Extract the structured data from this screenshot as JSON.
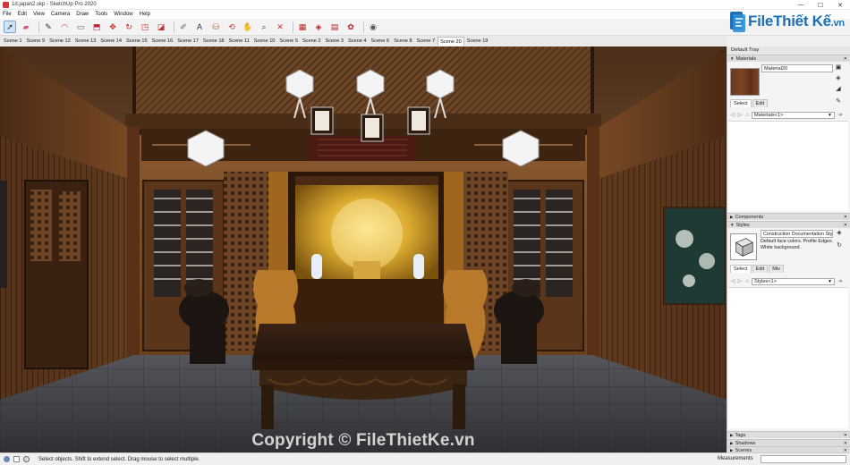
{
  "window": {
    "title": "1d.japan2.skp - SketchUp Pro 2020",
    "controls": [
      "—",
      "☐",
      "✕"
    ]
  },
  "menu": [
    "File",
    "Edit",
    "View",
    "Camera",
    "Draw",
    "Tools",
    "Window",
    "Help"
  ],
  "toolbar": {
    "tools": [
      {
        "icon": "select-arrow-icon",
        "glyph": "➚",
        "active": true
      },
      {
        "icon": "eraser-icon",
        "glyph": "▰",
        "color": "#d55a7a"
      },
      {
        "icon": "pencil-line-icon",
        "glyph": "✎",
        "color": "#333"
      },
      {
        "icon": "arc-icon",
        "glyph": "◠",
        "color": "#c33"
      },
      {
        "icon": "rectangle-icon",
        "glyph": "▭",
        "color": "#7a5a3a"
      },
      {
        "icon": "push-pull-icon",
        "glyph": "⬒",
        "color": "#b23"
      },
      {
        "icon": "move-icon",
        "glyph": "✥",
        "color": "#c22"
      },
      {
        "icon": "rotate-icon",
        "glyph": "↻",
        "color": "#c22"
      },
      {
        "icon": "scale-icon",
        "glyph": "◳",
        "color": "#c22"
      },
      {
        "icon": "offset-icon",
        "glyph": "◪",
        "color": "#b33"
      },
      {
        "icon": "tape-measure-icon",
        "glyph": "✐",
        "color": "#666"
      },
      {
        "icon": "text-icon",
        "glyph": "A",
        "color": "#333"
      },
      {
        "icon": "paint-bucket-icon",
        "glyph": "⛁",
        "color": "#a63"
      },
      {
        "icon": "orbit-icon",
        "glyph": "⟲",
        "color": "#b33"
      },
      {
        "icon": "pan-icon",
        "glyph": "✋",
        "color": "#a52"
      },
      {
        "icon": "zoom-icon",
        "glyph": "⌕",
        "color": "#333"
      },
      {
        "icon": "zoom-extents-icon",
        "glyph": "✕",
        "color": "#c33"
      },
      {
        "icon": "warehouse-icon",
        "glyph": "▦",
        "color": "#b22"
      },
      {
        "icon": "extension-warehouse-icon",
        "glyph": "◈",
        "color": "#b22"
      },
      {
        "icon": "layout-icon",
        "glyph": "▤",
        "color": "#b22"
      },
      {
        "icon": "extension-manager-icon",
        "glyph": "✿",
        "color": "#b22"
      },
      {
        "icon": "account-icon",
        "glyph": "◉",
        "color": "#555"
      }
    ]
  },
  "scenes": [
    "Scene 1",
    "Scene 9",
    "Scene 12",
    "Scene 13",
    "Scene 14",
    "Scene 15",
    "Scene 16",
    "Scene 17",
    "Scene 18",
    "Scene 11",
    "Scene 10",
    "Scene 5",
    "Scene 2",
    "Scene 3",
    "Scene 4",
    "Scene 6",
    "Scene 8",
    "Scene 7",
    "Scene 20",
    "Scene 19"
  ],
  "active_scene": "Scene 20",
  "logo": {
    "brand": "File",
    "brand2": "Thiết Kế",
    "suffix": ".vn"
  },
  "watermark": "Copyright © FileThietKe.vn",
  "tray": {
    "title": "Default Tray",
    "materials": {
      "header": "Materials",
      "name": "Material20",
      "tabs": [
        "Select",
        "Edit"
      ],
      "collection": "Materials<1>"
    },
    "components": {
      "header": "Components"
    },
    "styles": {
      "header": "Styles",
      "name": "Construction Documentation Sty",
      "description": "Default face colors. Profile Edges. White background.",
      "tabs": [
        "Select",
        "Edit",
        "Mix"
      ],
      "collection": "Styles<1>"
    },
    "collapsed": [
      "Tags",
      "Shadows",
      "Scenes"
    ]
  },
  "status": {
    "hint": "Select objects. Shift to extend select. Drag mouse to select multiple.",
    "measurements_label": "Measurements",
    "measurements_value": ""
  },
  "colors": {
    "accent": "#1a6fb5",
    "wood_dark": "#3a2414",
    "wood_mid": "#7a4a26",
    "floor": "#47484d",
    "gold": "#c9a02a"
  }
}
